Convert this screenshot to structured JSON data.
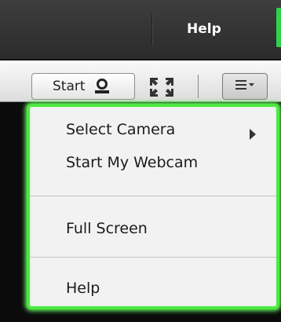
{
  "topbar": {
    "help_label": "Help"
  },
  "toolbar": {
    "start_label": "Start",
    "icons": {
      "start": "user-icon",
      "fullscreen": "fullscreen-icon",
      "menu": "options-menu-icon"
    }
  },
  "menu": {
    "items": [
      {
        "label": "Select Camera",
        "submenu": true
      },
      {
        "label": "Start My Webcam"
      },
      {
        "label": "Full Screen"
      },
      {
        "label": "Help"
      }
    ]
  },
  "colors": {
    "highlight": "#4ee840",
    "accent_green": "#2fd34a"
  }
}
